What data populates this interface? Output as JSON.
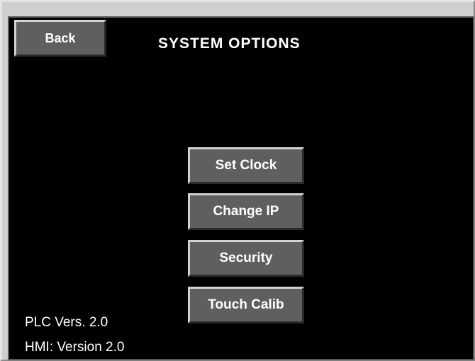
{
  "header": {
    "back_label": "Back",
    "title": "SYSTEM OPTIONS"
  },
  "menu": {
    "items": [
      {
        "label": "Set Clock"
      },
      {
        "label": "Change IP"
      },
      {
        "label": "Security"
      },
      {
        "label": "Touch Calib"
      }
    ]
  },
  "footer": {
    "plc_version": "PLC Vers. 2.0",
    "hmi_version": "HMI: Version 2.0"
  },
  "colors": {
    "screen_background": "#000000",
    "button_face": "#5f5f5f",
    "text": "#ffffff"
  }
}
